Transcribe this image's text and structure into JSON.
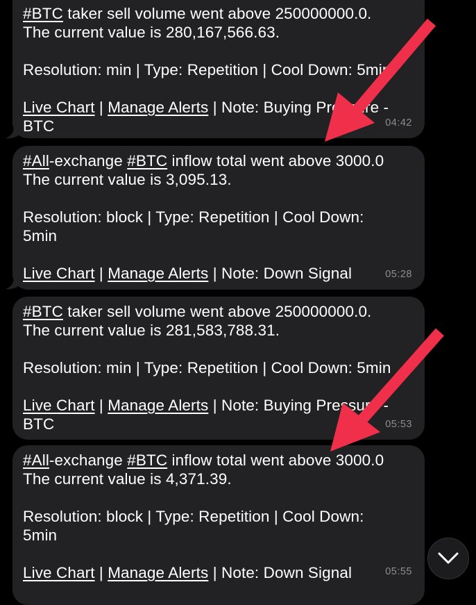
{
  "colors": {
    "background": "#000000",
    "bubble": "#222224",
    "text": "#ffffff",
    "timestamp": "#8d8d92",
    "annotation_arrow": "#f0304a"
  },
  "separator": " | ",
  "messages": [
    {
      "type": "taker-sell",
      "line1": {
        "tag": "#BTC",
        "rest": " taker sell volume went above 250000000.0."
      },
      "line2": "The current value is 280,167,566.63.",
      "meta": [
        "Resolution: min | Type: Repetition | Cool Down: 5min"
      ],
      "links": {
        "live_chart": "Live Chart",
        "manage_alerts": "Manage Alerts"
      },
      "note": "Note: Buying Pressure -",
      "note_cont": "BTC",
      "time": "04:42"
    },
    {
      "type": "inflow",
      "line1": {
        "tag1": "#All",
        "mid": "-exchange ",
        "tag2": "#BTC",
        "rest": " inflow total went above 3000.0"
      },
      "line2": "The current value is 3,095.13.",
      "meta": [
        "Resolution: block | Type: Repetition | Cool Down:",
        "5min"
      ],
      "links": {
        "live_chart": "Live Chart",
        "manage_alerts": "Manage Alerts"
      },
      "note": "Note: Down Signal",
      "time": "05:28"
    },
    {
      "type": "taker-sell",
      "line1": {
        "tag": "#BTC",
        "rest": " taker sell volume went above 250000000.0."
      },
      "line2": "The current value is 281,583,788.31.",
      "meta": [
        "Resolution: min | Type: Repetition | Cool Down: 5min"
      ],
      "links": {
        "live_chart": "Live Chart",
        "manage_alerts": "Manage Alerts"
      },
      "note": "Note: Buying Pressure -",
      "note_cont": "BTC",
      "time": "05:53"
    },
    {
      "type": "inflow",
      "line1": {
        "tag1": "#All",
        "mid": "-exchange ",
        "tag2": "#BTC",
        "rest": " inflow total went above 3000.0"
      },
      "line2": "The current value is 4,371.39.",
      "meta": [
        "Resolution: block | Type: Repetition | Cool Down:",
        "5min"
      ],
      "links": {
        "live_chart": "Live Chart",
        "manage_alerts": "Manage Alerts"
      },
      "note": "Note: Down Signal",
      "time": "05:55"
    }
  ],
  "scroll_button": {
    "icon": "chevron-down-icon"
  }
}
